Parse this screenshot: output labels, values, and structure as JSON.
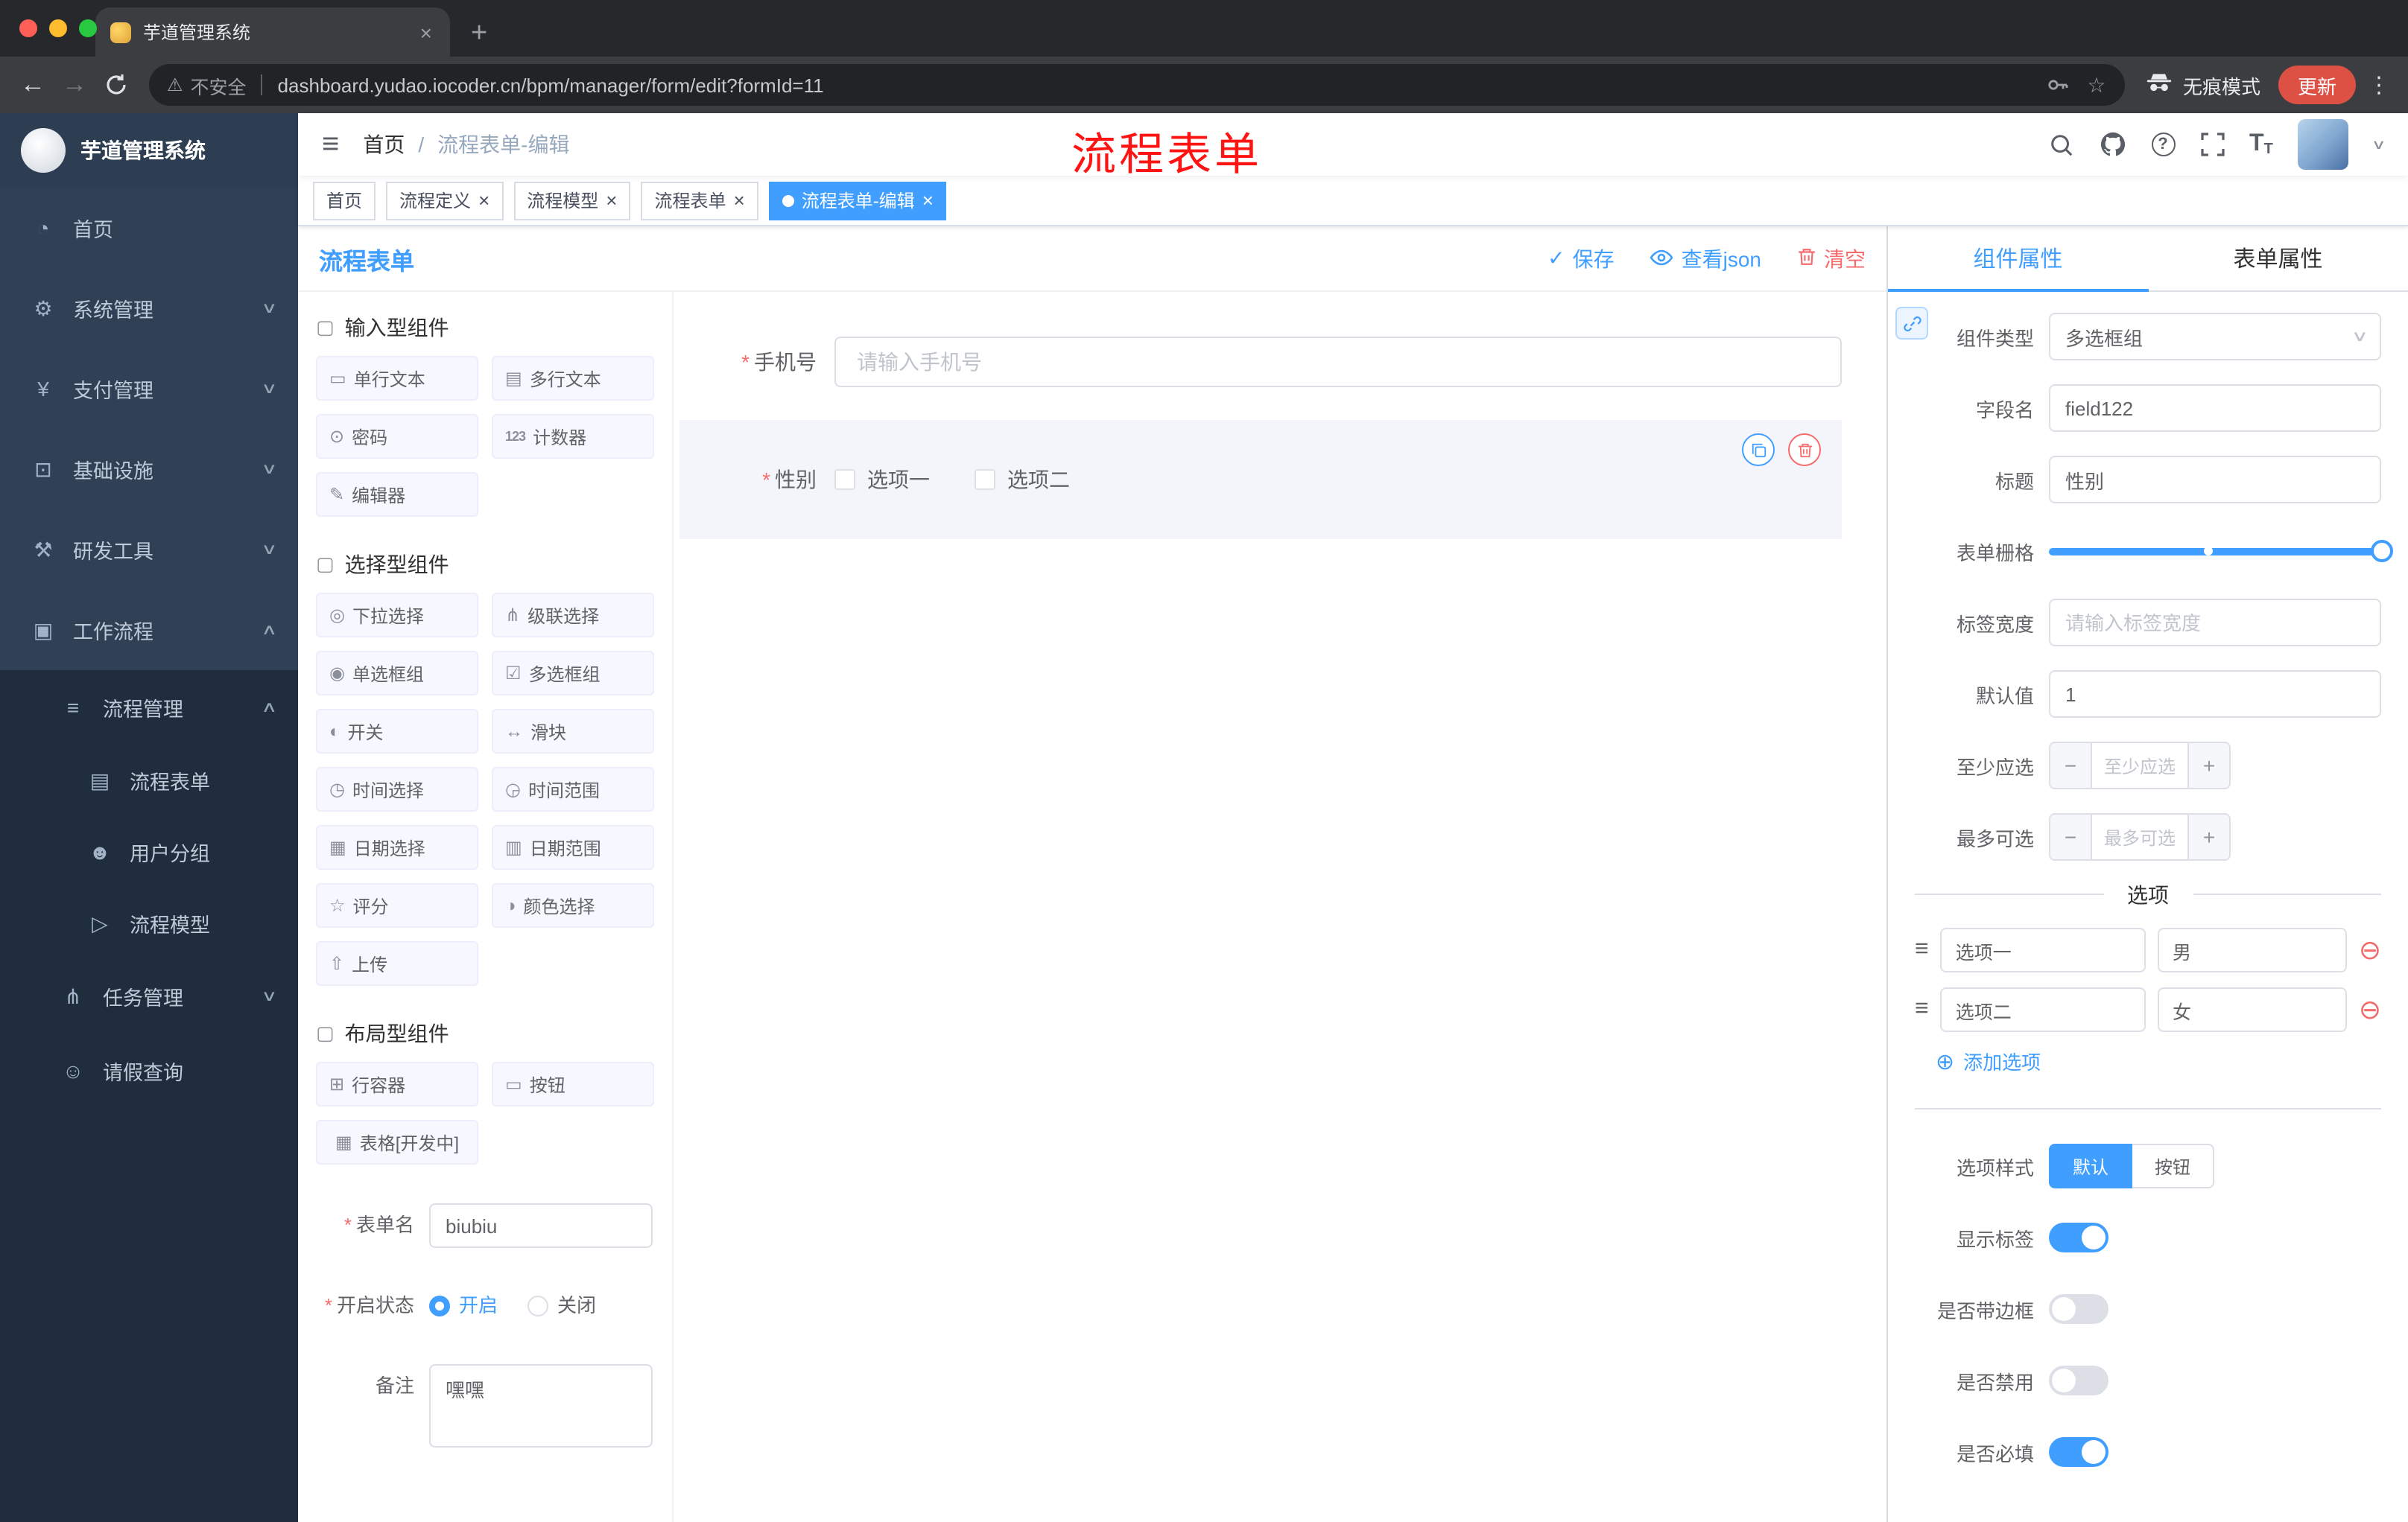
{
  "browser": {
    "tab_title": "芋道管理系统",
    "security_text": "不安全",
    "url": "dashboard.yudao.iocoder.cn/bpm/manager/form/edit?formId=11",
    "incognito_label": "无痕模式",
    "update_label": "更新"
  },
  "glyphs": {
    "close": "×",
    "plus": "+",
    "back": "←",
    "forward": "→",
    "hamburger": "≡",
    "kebab": "⋮",
    "warning": "⚠",
    "star": "☆",
    "check": "✓",
    "minus": "−",
    "plus_small": "+",
    "add": "⊕",
    "remove": "⊖",
    "drag": "≡",
    "chevron": "∨",
    "question": "?",
    "required": "*",
    "font_large": "T",
    "font_small": "T"
  },
  "sidebar": {
    "logo_title": "芋道管理系统",
    "items": [
      {
        "glyph": "◔",
        "label": "首页",
        "chevron": ""
      },
      {
        "glyph": "⚙",
        "label": "系统管理",
        "chevron": "∨"
      },
      {
        "glyph": "¥",
        "label": "支付管理",
        "chevron": "∨"
      },
      {
        "glyph": "⊡",
        "label": "基础设施",
        "chevron": "∨"
      },
      {
        "glyph": "⚒",
        "label": "研发工具",
        "chevron": "∨"
      },
      {
        "glyph": "▣",
        "label": "工作流程",
        "chevron": "∧"
      },
      {
        "glyph": "≡",
        "label": "流程管理",
        "chevron": "∧"
      },
      {
        "glyph": "▤",
        "label": "流程表单",
        "chevron": ""
      },
      {
        "glyph": "☻",
        "label": "用户分组",
        "chevron": ""
      },
      {
        "glyph": "▷",
        "label": "流程模型",
        "chevron": ""
      },
      {
        "glyph": "⋔",
        "label": "任务管理",
        "chevron": "∨"
      },
      {
        "glyph": "☺",
        "label": "请假查询",
        "chevron": ""
      }
    ]
  },
  "header": {
    "breadcrumb_home": "首页",
    "breadcrumb_sep": "/",
    "breadcrumb_current": "流程表单-编辑",
    "overlay_title": "流程表单"
  },
  "tags": [
    {
      "label": "首页"
    },
    {
      "label": "流程定义"
    },
    {
      "label": "流程模型"
    },
    {
      "label": "流程表单"
    },
    {
      "label": "流程表单-编辑"
    }
  ],
  "toolbar": {
    "title": "流程表单",
    "save_label": "保存",
    "view_json_label": "查看json",
    "clear_label": "清空"
  },
  "palette": {
    "sections": [
      {
        "title": "输入型组件",
        "items": [
          {
            "glyph": "▭",
            "label": "单行文本"
          },
          {
            "glyph": "▤",
            "label": "多行文本"
          },
          {
            "glyph": "⊙",
            "label": "密码"
          },
          {
            "glyph": "123",
            "label": "计数器"
          },
          {
            "glyph": "✎",
            "label": "编辑器"
          }
        ]
      },
      {
        "title": "选择型组件",
        "items": [
          {
            "glyph": "◎",
            "label": "下拉选择"
          },
          {
            "glyph": "⋔",
            "label": "级联选择"
          },
          {
            "glyph": "◉",
            "label": "单选框组"
          },
          {
            "glyph": "☑",
            "label": "多选框组"
          },
          {
            "glyph": "◐",
            "label": "开关"
          },
          {
            "glyph": "↔",
            "label": "滑块"
          },
          {
            "glyph": "◷",
            "label": "时间选择"
          },
          {
            "glyph": "◶",
            "label": "时间范围"
          },
          {
            "glyph": "▦",
            "label": "日期选择"
          },
          {
            "glyph": "▥",
            "label": "日期范围"
          },
          {
            "glyph": "☆",
            "label": "评分"
          },
          {
            "glyph": "◑",
            "label": "颜色选择"
          },
          {
            "glyph": "⇧",
            "label": "上传"
          }
        ]
      },
      {
        "title": "布局型组件",
        "items": [
          {
            "glyph": "⊞",
            "label": "行容器"
          },
          {
            "glyph": "▭",
            "label": "按钮"
          },
          {
            "glyph": "▦",
            "label": "表格[开发中]"
          }
        ]
      }
    ],
    "form": {
      "name_label": "表单名",
      "name_value": "biubiu",
      "status_label": "开启状态",
      "status_on": "开启",
      "status_off": "关闭",
      "remark_label": "备注",
      "remark_value": "嘿嘿"
    }
  },
  "canvas": {
    "phone_label": "手机号",
    "phone_placeholder": "请输入手机号",
    "gender_label": "性别",
    "gender_options": [
      "选项一",
      "选项二"
    ]
  },
  "props": {
    "tab_component": "组件属性",
    "tab_form": "表单属性",
    "type_label": "组件类型",
    "type_value": "多选框组",
    "field_label": "字段名",
    "field_value": "field122",
    "title_label": "标题",
    "title_value": "性别",
    "grid_label": "表单栅格",
    "label_width_label": "标签宽度",
    "label_width_placeholder": "请输入标签宽度",
    "default_label": "默认值",
    "default_value": "1",
    "min_label": "至少应选",
    "min_placeholder": "至少应选",
    "max_label": "最多可选",
    "max_placeholder": "最多可选",
    "options_title": "选项",
    "options": [
      {
        "label": "选项一",
        "value": "男"
      },
      {
        "label": "选项二",
        "value": "女"
      }
    ],
    "add_option_label": "添加选项",
    "style_label": "选项样式",
    "style_default": "默认",
    "style_button": "按钮",
    "sw_show": "显示标签",
    "sw_border": "是否带边框",
    "sw_disabled": "是否禁用",
    "sw_required": "是否必填"
  },
  "colors": {
    "accent": "#409eff",
    "danger": "#f56c6c",
    "sidebar_bg": "#304156",
    "submenu_bg": "#1f2d3d"
  }
}
